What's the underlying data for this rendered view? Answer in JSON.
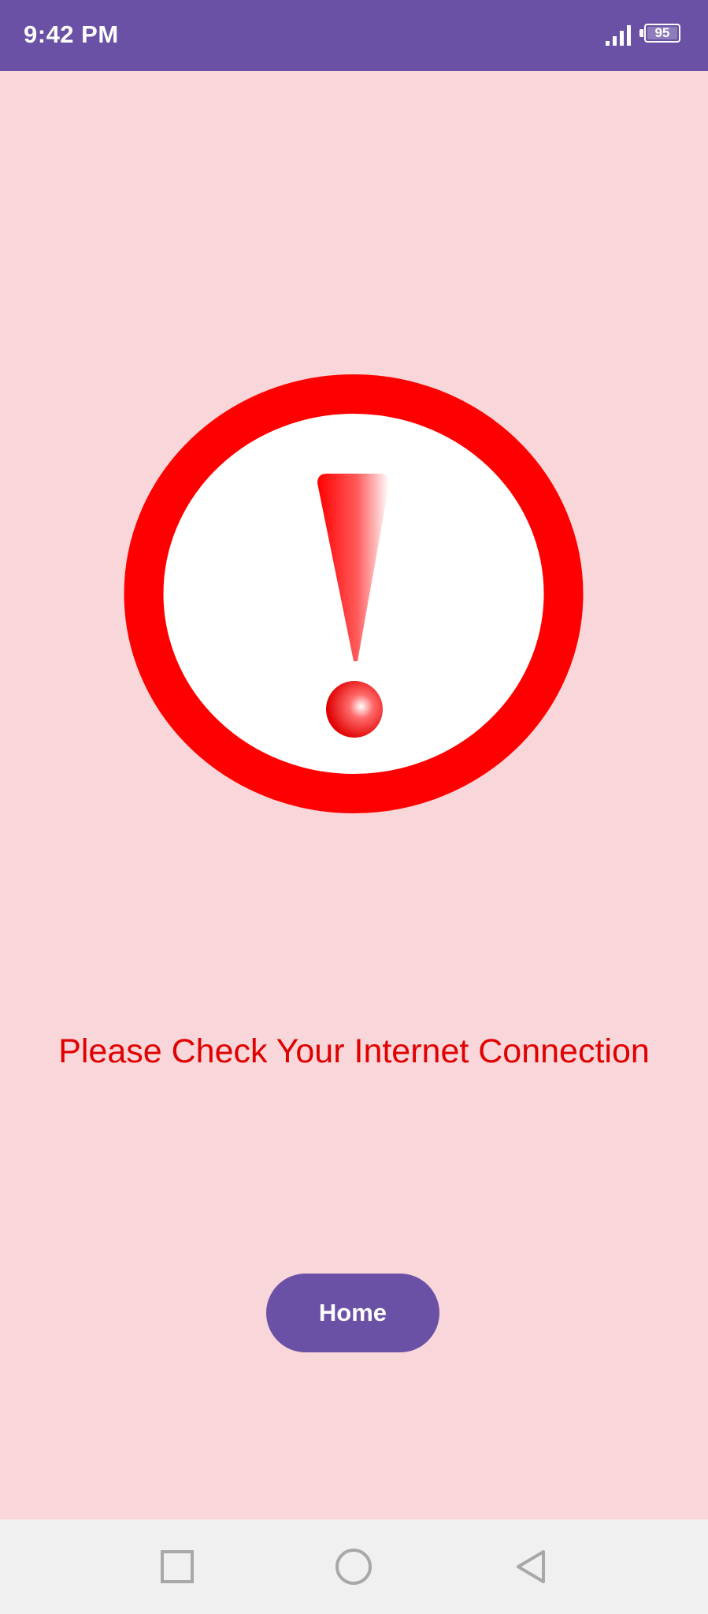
{
  "status_bar": {
    "time": "9:42 PM",
    "battery_level": "95",
    "icons": [
      "signal-icon",
      "battery-icon"
    ]
  },
  "alert": {
    "icon": "exclamation-warning-icon",
    "message": "Please Check Your Internet Connection"
  },
  "actions": {
    "home_label": "Home"
  },
  "nav_bar": {
    "icons": [
      "recent-apps-icon",
      "home-circle-icon",
      "back-triangle-icon"
    ]
  },
  "colors": {
    "status_bar": "#6a51a5",
    "background": "#f9d6d9",
    "alert_red": "#ff0000",
    "message_red": "#e00000",
    "button": "#6a51a5",
    "nav_bar": "#f0f0f0"
  }
}
